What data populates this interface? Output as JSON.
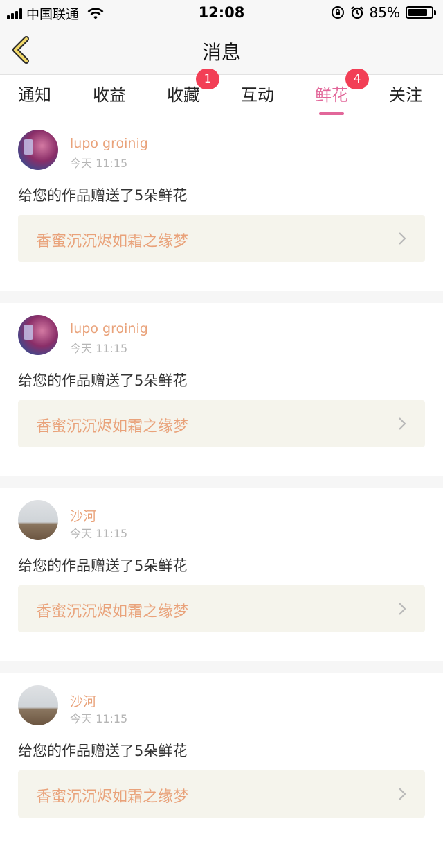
{
  "status_bar": {
    "carrier": "中国联通",
    "time": "12:08",
    "battery_percent": "85%",
    "battery_level": 0.85,
    "icons": [
      "signal-icon",
      "wifi-icon",
      "orientation-lock-icon",
      "alarm-icon",
      "battery-icon"
    ]
  },
  "nav": {
    "title": "消息",
    "back_icon": "chevron-left-icon",
    "accent_color": "#e2679a",
    "back_color": "#c8a12c"
  },
  "tabs": [
    {
      "label": "通知",
      "badge": null
    },
    {
      "label": "收益",
      "badge": null
    },
    {
      "label": "收藏",
      "badge": "1"
    },
    {
      "label": "互动",
      "badge": null
    },
    {
      "label": "鲜花",
      "badge": "4",
      "active": true
    },
    {
      "label": "关注",
      "badge": null
    }
  ],
  "feed": [
    {
      "username": "lupo groinig",
      "time": "今天 11:15",
      "message": "给您的作品赠送了5朵鲜花",
      "work_title": "香蜜沉沉烬如霜之缘梦"
    },
    {
      "username": "lupo groinig",
      "time": "今天 11:15",
      "message": "给您的作品赠送了5朵鲜花",
      "work_title": "香蜜沉沉烬如霜之缘梦"
    },
    {
      "username": "沙河",
      "time": "今天 11:15",
      "message": "给您的作品赠送了5朵鲜花",
      "work_title": "香蜜沉沉烬如霜之缘梦"
    },
    {
      "username": "沙河",
      "time": "今天 11:15",
      "message": "给您的作品赠送了5朵鲜花",
      "work_title": "香蜜沉沉烬如霜之缘梦"
    }
  ],
  "colors": {
    "username": "#e9a27a",
    "badge": "#f23f56",
    "work_card_bg": "#f5f4ec"
  }
}
